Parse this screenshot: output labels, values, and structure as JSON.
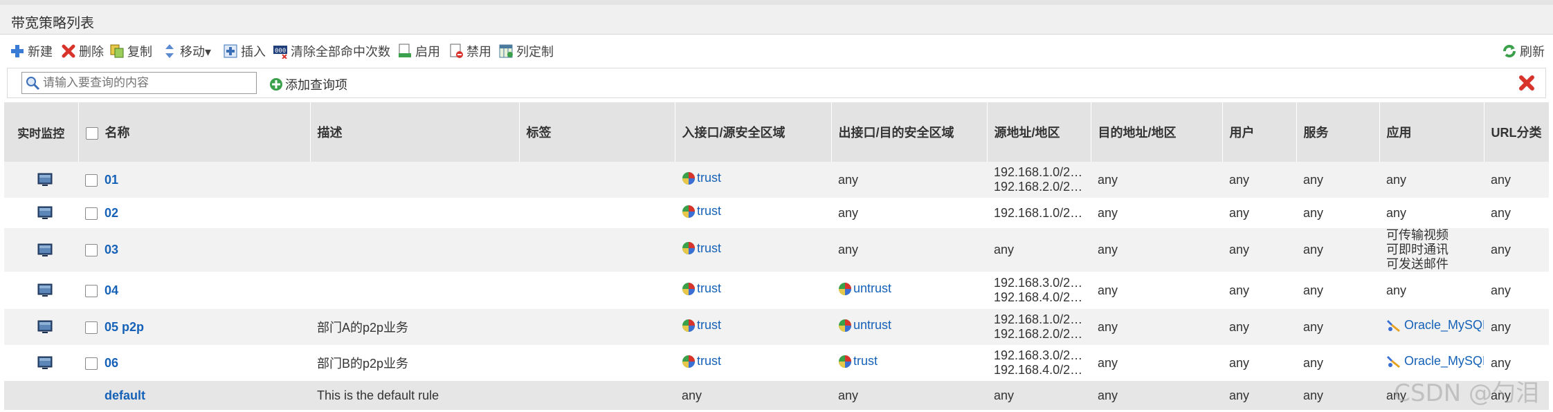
{
  "page_title": "带宽策略列表",
  "toolbar": {
    "new": "新建",
    "delete": "删除",
    "copy": "复制",
    "move": "移动▾",
    "insert": "插入",
    "clear_hits": "清除全部命中次数",
    "enable": "启用",
    "disable": "禁用",
    "columns": "列定制",
    "refresh": "刷新"
  },
  "search": {
    "placeholder": "请输入要查询的内容",
    "add_query": "添加查询项"
  },
  "columns": {
    "monitor": "实时监控",
    "name": "名称",
    "desc": "描述",
    "tag": "标签",
    "ingress": "入接口/源安全区域",
    "egress": "出接口/目的安全区域",
    "src": "源地址/地区",
    "dst": "目的地址/地区",
    "user": "用户",
    "service": "服务",
    "app": "应用",
    "url": "URL分类"
  },
  "rows": [
    {
      "name": "01",
      "desc": "",
      "tag": "",
      "ingress": "trust",
      "egress": "any",
      "src1": "192.168.1.0/2…",
      "src2": "192.168.2.0/2…",
      "dst": "any",
      "user": "any",
      "service": "any",
      "app1": "any",
      "app2": "",
      "app3": "",
      "url": "any"
    },
    {
      "name": "02",
      "desc": "",
      "tag": "",
      "ingress": "trust",
      "egress": "any",
      "src1": "192.168.1.0/2…",
      "src2": "",
      "dst": "any",
      "user": "any",
      "service": "any",
      "app1": "any",
      "app2": "",
      "app3": "",
      "url": "any"
    },
    {
      "name": "03",
      "desc": "",
      "tag": "",
      "ingress": "trust",
      "egress": "any",
      "src1": "any",
      "src2": "",
      "dst": "any",
      "user": "any",
      "service": "any",
      "app1": "可传输视频",
      "app2": "可即时通讯",
      "app3": "可发送邮件",
      "url": "any"
    },
    {
      "name": "04",
      "desc": "",
      "tag": "",
      "ingress": "trust",
      "egress": "untrust",
      "src1": "192.168.3.0/2…",
      "src2": "192.168.4.0/2…",
      "dst": "any",
      "user": "any",
      "service": "any",
      "app1": "any",
      "app2": "",
      "app3": "",
      "url": "any"
    },
    {
      "name": "05 p2p",
      "desc": "部门A的p2p业务",
      "tag": "",
      "ingress": "trust",
      "egress": "untrust",
      "src1": "192.168.1.0/2…",
      "src2": "192.168.2.0/2…",
      "dst": "any",
      "user": "any",
      "service": "any",
      "app1": "Oracle_MySQL",
      "app2": "",
      "app3": "",
      "url": "any"
    },
    {
      "name": "06",
      "desc": "部门B的p2p业务",
      "tag": "",
      "ingress": "trust",
      "egress": "trust",
      "src1": "192.168.3.0/2…",
      "src2": "192.168.4.0/2…",
      "dst": "any",
      "user": "any",
      "service": "any",
      "app1": "Oracle_MySQL",
      "app2": "",
      "app3": "",
      "url": "any"
    }
  ],
  "default_row": {
    "name": "default",
    "desc": "This is the default rule",
    "ingress": "any",
    "egress": "any",
    "src": "any",
    "dst": "any",
    "user": "any",
    "service": "any",
    "app": "any",
    "url": "any"
  },
  "watermark": "CSDN @勺泪",
  "colors": {
    "link": "#1561b8",
    "header_bg": "#e3e3e3",
    "row_alt": "#f2f2f2"
  }
}
